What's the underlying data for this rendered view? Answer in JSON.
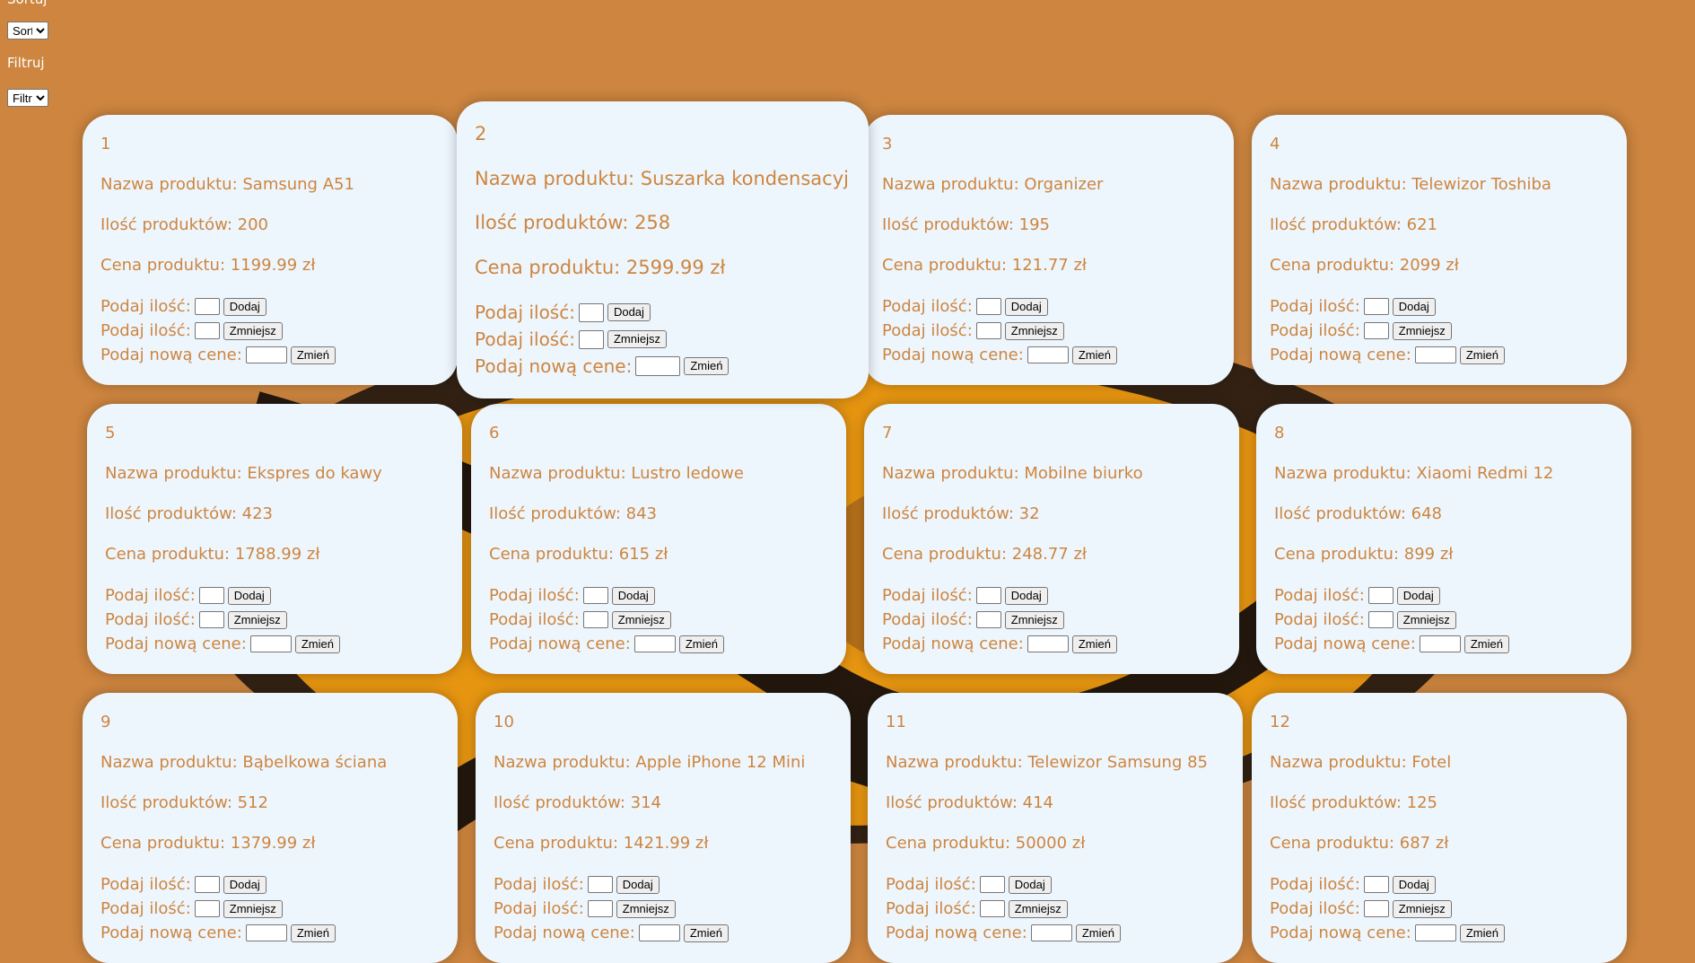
{
  "controls": {
    "sort_label": "Sortuj",
    "sort_value": "Sort",
    "filter_label": "Filtruj",
    "filter_value": "Filtr"
  },
  "labels": {
    "name": "Nazwa produktu: ",
    "qty": "Ilość produktów: ",
    "price": "Cena produktu: ",
    "enter_qty": "Podaj ilość:",
    "enter_price": "Podaj nową cene:",
    "add": "Dodaj",
    "decrease": "Zmniejsz",
    "change": "Zmień",
    "currency": " zł"
  },
  "products": [
    {
      "id": "1",
      "name": "Samsung A51",
      "qty": "200",
      "price": "1199.99"
    },
    {
      "id": "2",
      "name": "Suszarka kondensacyj",
      "qty": "258",
      "price": "2599.99"
    },
    {
      "id": "3",
      "name": "Organizer",
      "qty": "195",
      "price": "121.77"
    },
    {
      "id": "4",
      "name": "Telewizor Toshiba",
      "qty": "621",
      "price": "2099"
    },
    {
      "id": "5",
      "name": "Ekspres do kawy",
      "qty": "423",
      "price": "1788.99"
    },
    {
      "id": "6",
      "name": "Lustro ledowe",
      "qty": "843",
      "price": "615"
    },
    {
      "id": "7",
      "name": "Mobilne biurko",
      "qty": "32",
      "price": "248.77"
    },
    {
      "id": "8",
      "name": "Xiaomi Redmi 12",
      "qty": "648",
      "price": "899"
    },
    {
      "id": "9",
      "name": "Bąbelkowa ściana",
      "qty": "512",
      "price": "1379.99"
    },
    {
      "id": "10",
      "name": "Apple iPhone 12 Mini",
      "qty": "314",
      "price": "1421.99"
    },
    {
      "id": "11",
      "name": "Telewizor Samsung 85",
      "qty": "414",
      "price": "50000"
    },
    {
      "id": "12",
      "name": "Fotel",
      "qty": "125",
      "price": "687"
    }
  ]
}
